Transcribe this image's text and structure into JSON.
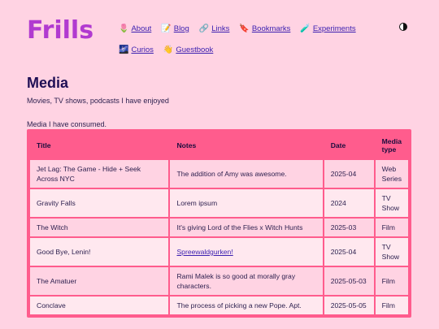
{
  "site": {
    "logo": "Frills"
  },
  "nav": {
    "row1": [
      {
        "emoji": "🌷",
        "label": "About"
      },
      {
        "emoji": "📝",
        "label": "Blog"
      },
      {
        "emoji": "🔗",
        "label": "Links"
      },
      {
        "emoji": "🔖",
        "label": "Bookmarks"
      },
      {
        "emoji": "🧪",
        "label": "Experiments"
      }
    ],
    "row2": [
      {
        "emoji": "🌌",
        "label": "Curios"
      },
      {
        "emoji": "👋",
        "label": "Guestbook"
      }
    ]
  },
  "page": {
    "title": "Media",
    "subtitle": "Movies, TV shows, podcasts I have enjoyed",
    "caption": "Media I have consumed."
  },
  "table": {
    "headers": [
      "Title",
      "Notes",
      "Date",
      "Media type"
    ],
    "rows": [
      {
        "title": "Jet Lag: The Game - Hide + Seek Across NYC",
        "notes": "The addition of Amy was awesome.",
        "date": "2025-04",
        "type": "Web Series"
      },
      {
        "title": "Gravity Falls",
        "notes": "Lorem ipsum",
        "date": "2024",
        "type": "TV Show"
      },
      {
        "title": "The Witch",
        "notes": "It's giving Lord of the Flies x Witch Hunts",
        "date": "2025-03",
        "type": "Film"
      },
      {
        "title": "Good Bye, Lenin!",
        "notes": "Spreewaldgurken!",
        "date": "2025-04",
        "type": "TV Show"
      },
      {
        "title": "The Amatuer",
        "notes": "Rami Malek is so good at morally gray characters.",
        "date": "2025-05-03",
        "type": "Film"
      },
      {
        "title": "Conclave",
        "notes": "The process of picking a new Pope. Apt.",
        "date": "2025-05-05",
        "type": "Film"
      }
    ]
  },
  "colors": {
    "background": "#ffd3e3",
    "accent": "#ff5c8d",
    "logo": "#b13ad0",
    "link": "#3b1fb0"
  }
}
